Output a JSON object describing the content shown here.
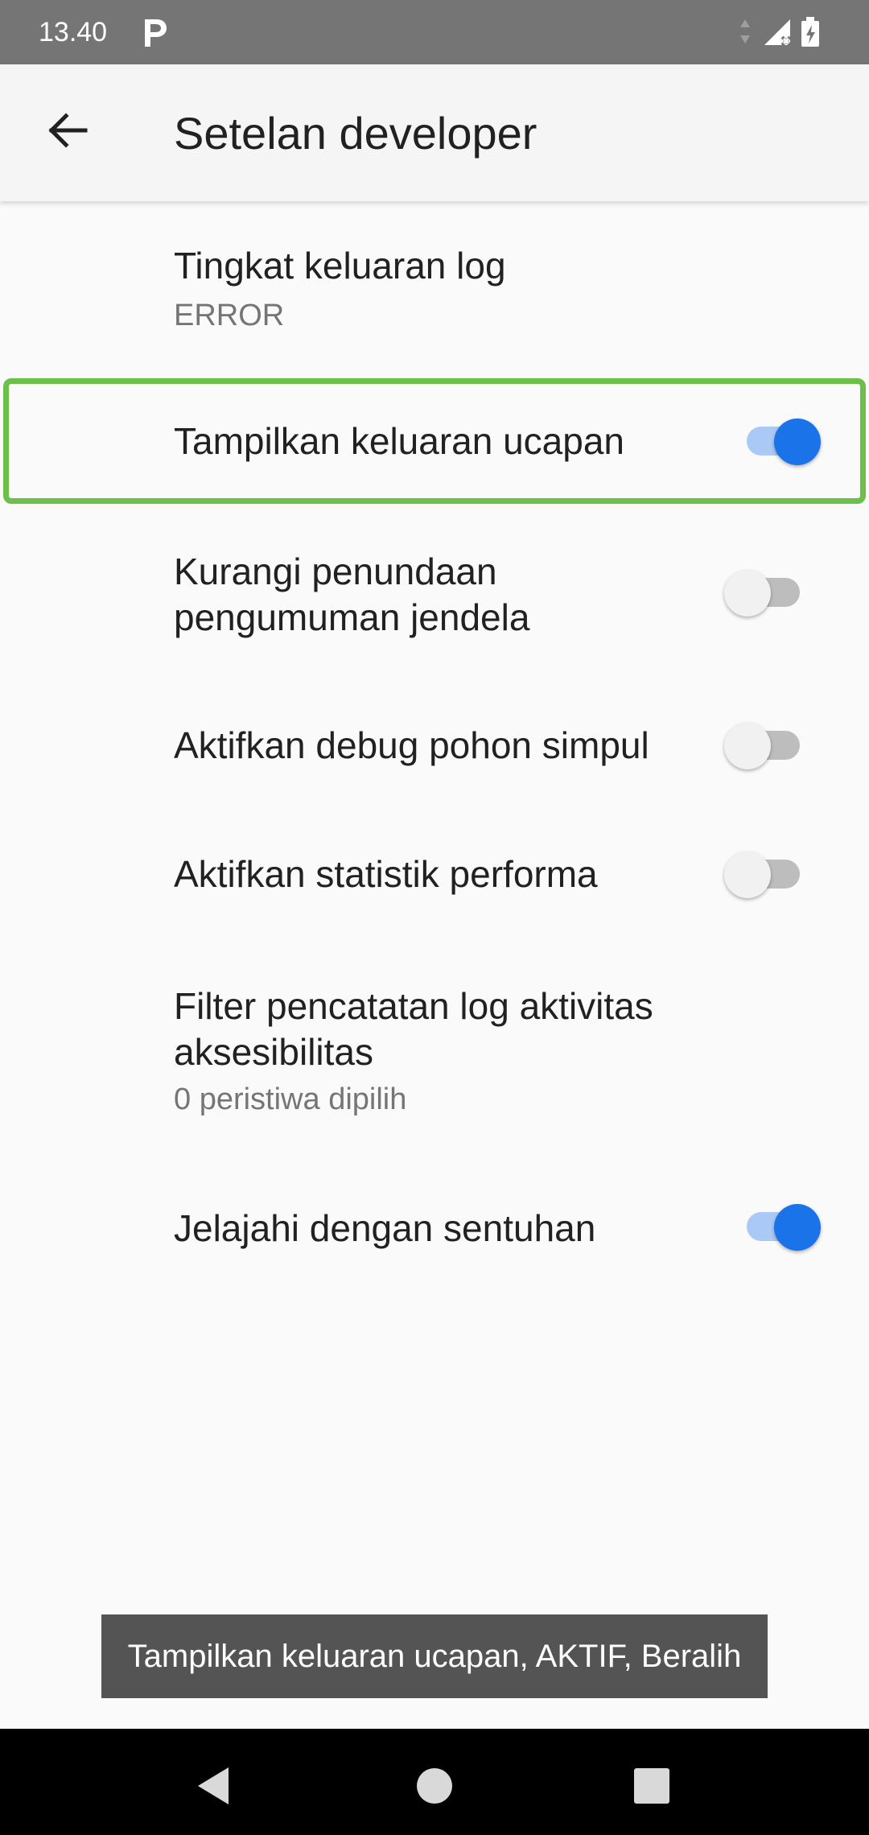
{
  "status_bar": {
    "time": "13.40",
    "app_icon": "p-icon",
    "icons": [
      "data-arrows-icon",
      "signal-no-sim-icon",
      "battery-charging-icon"
    ]
  },
  "app_bar": {
    "title": "Setelan developer",
    "back_icon": "arrow-back-icon"
  },
  "settings": [
    {
      "title": "Tingkat keluaran log",
      "subtitle": "ERROR"
    },
    {
      "title": "Tampilkan keluaran ucapan",
      "switch": true,
      "focused": true
    },
    {
      "title_lines": [
        "Kurangi penundaan",
        "pengumuman jendela"
      ],
      "switch": false
    },
    {
      "title": "Aktifkan debug pohon simpul",
      "switch": false
    },
    {
      "title": "Aktifkan statistik performa",
      "switch": false
    },
    {
      "title_lines": [
        "Filter pencatatan log aktivitas",
        "aksesibilitas"
      ],
      "subtitle": "0 peristiwa dipilih"
    },
    {
      "title": "Jelajahi dengan sentuhan",
      "switch": true
    }
  ],
  "toast": {
    "text": "Tampilkan keluaran ucapan, AKTIF, Beralih"
  },
  "nav_bar": {
    "buttons": [
      "back-triangle-icon",
      "home-circle-icon",
      "recents-square-icon"
    ]
  },
  "colors": {
    "accent": "#1a73e8",
    "focus": "#6cc04a",
    "status_bar": "#757575"
  }
}
